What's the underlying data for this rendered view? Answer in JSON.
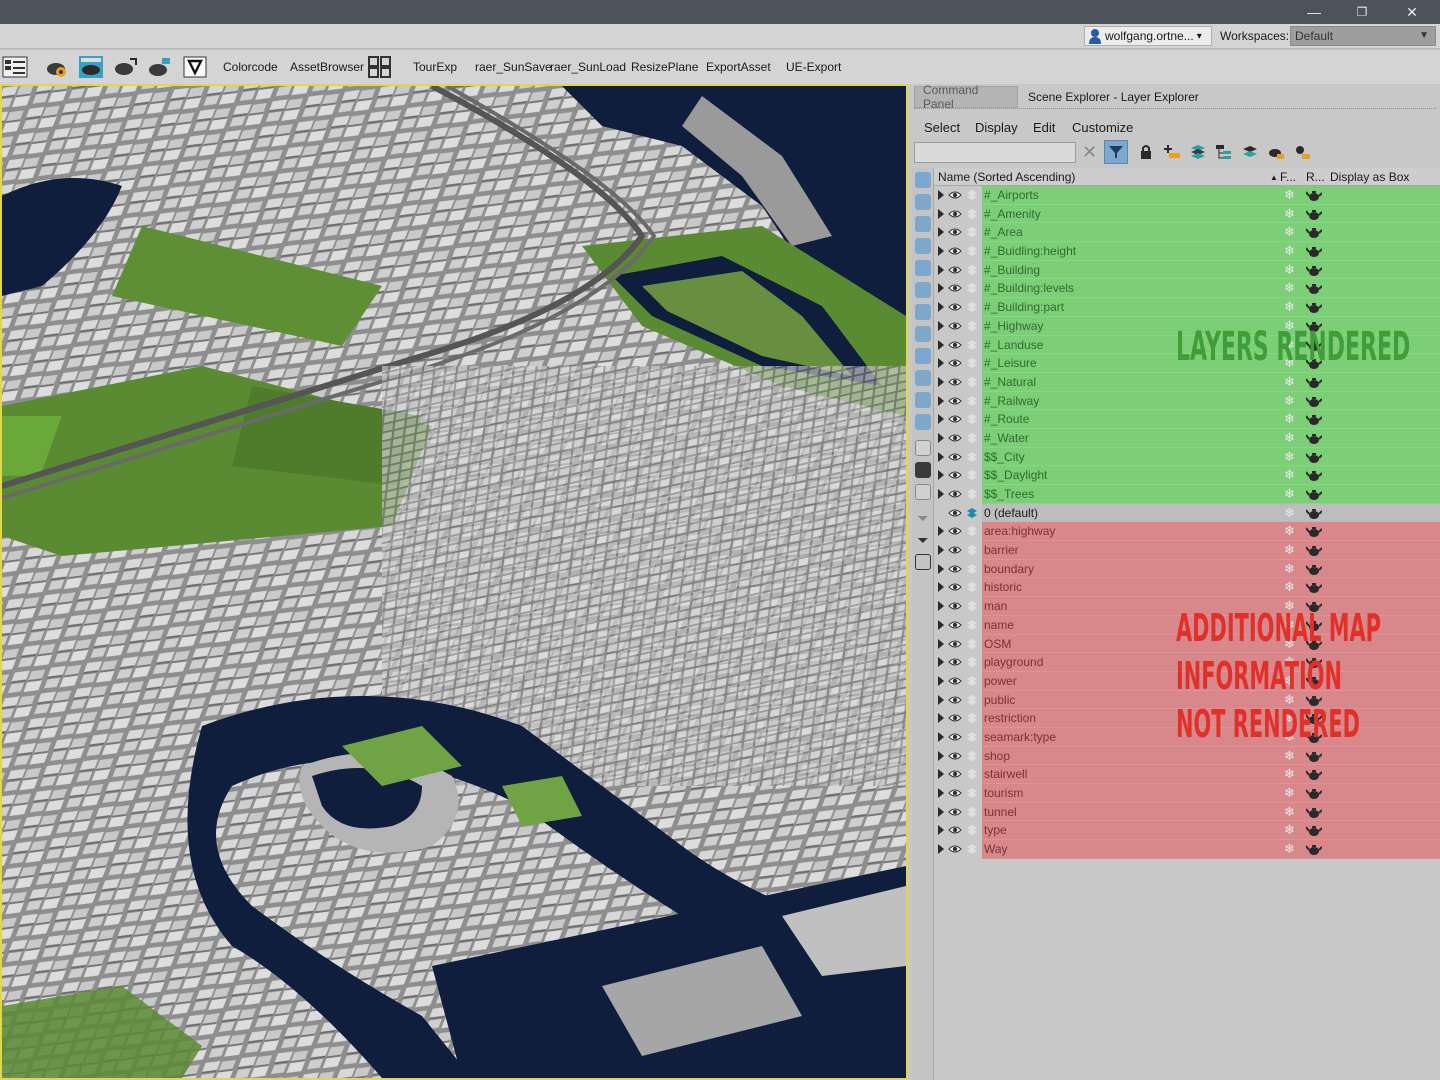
{
  "window": {
    "minimize_glyph": "—",
    "restore_glyph": "❐",
    "close_glyph": "✕"
  },
  "topbar": {
    "user": "wolfgang.ortne...",
    "user_arrow": "▾",
    "workspaces_label": "Workspaces:",
    "workspace_value": "Default",
    "workspace_arrow": "▼"
  },
  "toolbar": {
    "buttons": [
      "Colorcode",
      "AssetBrowser",
      "TourExp",
      "raer_SunSave",
      "raer_SunLoad",
      "ResizePlane",
      "ExportAsset",
      "UE-Export"
    ]
  },
  "panel": {
    "tabs": [
      "Command Panel",
      "Scene Explorer - Layer Explorer"
    ],
    "menu": [
      "Select",
      "Display",
      "Edit",
      "Customize"
    ],
    "search_placeholder": "",
    "clear_glyph": "✕",
    "columns": {
      "name": "Name (Sorted Ascending)",
      "sort_glyph": "▲",
      "freeze": "F...",
      "render": "R...",
      "box": "Display as Box"
    },
    "rows_green": [
      "#_Airports",
      "#_Amenity",
      "#_Area",
      "#_Buidling:height",
      "#_Building",
      "#_Building:levels",
      "#_Building:part",
      "#_Highway",
      "#_Landuse",
      "#_Leisure",
      "#_Natural",
      "#_Railway",
      "#_Route",
      "#_Water",
      "$$_City",
      "$$_Daylight",
      "$$_Trees"
    ],
    "row_default": "0 (default)",
    "rows_red": [
      "area:highway",
      "barrier",
      "boundary",
      "historic",
      "man",
      "name",
      "OSM",
      "playground",
      "power",
      "public",
      "restriction",
      "seamark:type",
      "shop",
      "stairwell",
      "tourism",
      "tunnel",
      "type",
      "Way"
    ],
    "snow_glyph": "❄"
  },
  "annotations": {
    "rendered": "LAYERS RENDERED",
    "additional_1": "ADDITIONAL MAP",
    "additional_2": "INFORMATION",
    "additional_3": "NOT RENDERED"
  },
  "colors": {
    "rendered_bg": "#7dcf77",
    "not_rendered_bg": "#d8878a",
    "viewport_border": "#e0d84a",
    "water": "#0f1e3c",
    "park": "#5a8a32"
  }
}
